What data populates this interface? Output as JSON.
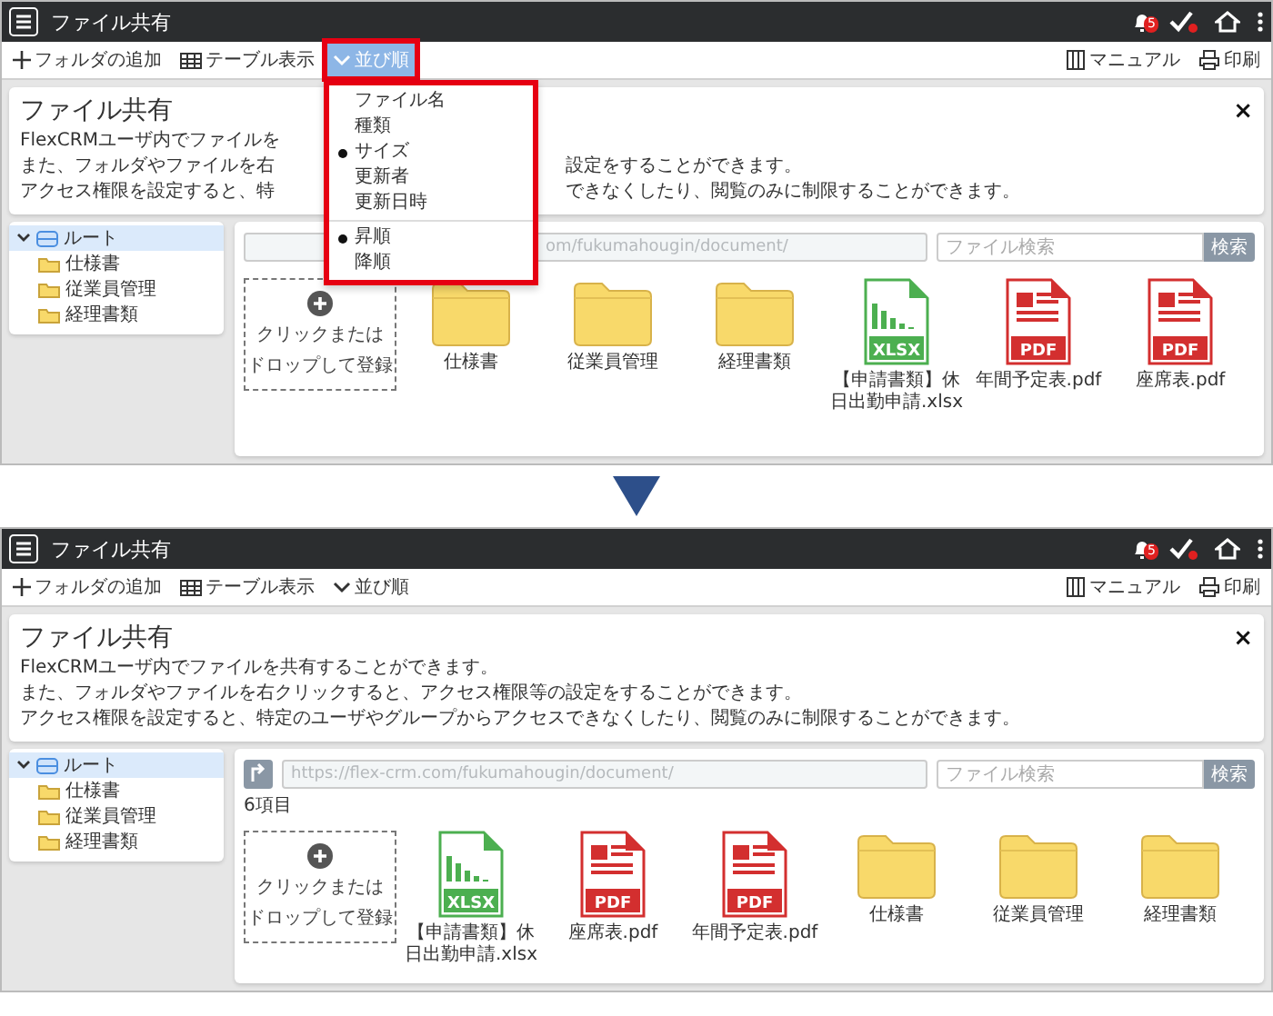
{
  "screens": [
    {
      "title": "ファイル共有",
      "notification_count": "5",
      "toolbar_left": [
        {
          "label": "フォルダの追加",
          "kind": "add",
          "active": false,
          "highlighted": false
        },
        {
          "label": "テーブル表示",
          "kind": "table",
          "active": false,
          "highlighted": false
        },
        {
          "label": "並び順",
          "kind": "sort",
          "active": true,
          "highlighted": true
        }
      ],
      "toolbar_right": [
        {
          "label": "マニュアル",
          "kind": "manual"
        },
        {
          "label": "印刷",
          "kind": "print"
        }
      ],
      "info": {
        "title": "ファイル共有",
        "close": "×",
        "lines": [
          {
            "text": "FlexCRMユーザ内でファイルを"
          },
          {
            "text": "また、フォルダやファイルを右",
            "after": "設定をすることができます。"
          },
          {
            "text": "アクセス権限を設定すると、特",
            "after": "できなくしたり、閲覧のみに制限することができます。"
          }
        ]
      },
      "tree": {
        "label": "ルート",
        "expanded": true,
        "selected": true,
        "children": [
          {
            "label": "仕様書",
            "selected": false
          },
          {
            "label": "従業員管理",
            "selected": false
          },
          {
            "label": "経理書類",
            "selected": false
          }
        ]
      },
      "path": "om/fukumahougin/document/",
      "search_placeholder": "ファイル検索",
      "search_button": "検索",
      "upload": [
        "クリックまたは",
        "ドロップして登録"
      ],
      "files": [
        {
          "kind": "folder",
          "name": "仕様書"
        },
        {
          "kind": "folder",
          "name": "従業員管理"
        },
        {
          "kind": "folder",
          "name": "経理書類"
        },
        {
          "kind": "xlsx",
          "badge": "XLSX",
          "name": "【申請書類】休日出勤申請.xlsx"
        },
        {
          "kind": "pdf",
          "badge": "PDF",
          "name": "年間予定表.pdf"
        },
        {
          "kind": "pdf",
          "badge": "PDF",
          "name": "座席表.pdf"
        }
      ],
      "sort_menu": {
        "highlighted": true,
        "groups": [
          [
            {
              "label": "ファイル名",
              "selected": false
            },
            {
              "label": "種類",
              "selected": false
            },
            {
              "label": "サイズ",
              "selected": true
            },
            {
              "label": "更新者",
              "selected": false
            },
            {
              "label": "更新日時",
              "selected": false
            }
          ],
          [
            {
              "label": "昇順",
              "selected": true
            },
            {
              "label": "降順",
              "selected": false
            }
          ]
        ]
      }
    },
    {
      "title": "ファイル共有",
      "notification_count": "5",
      "toolbar_left": [
        {
          "label": "フォルダの追加",
          "kind": "add",
          "active": false,
          "highlighted": false
        },
        {
          "label": "テーブル表示",
          "kind": "table",
          "active": false,
          "highlighted": false
        },
        {
          "label": "並び順",
          "kind": "sort",
          "active": false,
          "highlighted": false
        }
      ],
      "toolbar_right": [
        {
          "label": "マニュアル",
          "kind": "manual"
        },
        {
          "label": "印刷",
          "kind": "print"
        }
      ],
      "info": {
        "title": "ファイル共有",
        "close": "×",
        "lines": [
          {
            "text": "FlexCRMユーザ内でファイルを共有することができます。"
          },
          {
            "text": "また、フォルダやファイルを右クリックすると、アクセス権限等の設定をすることができます。"
          },
          {
            "text": "アクセス権限を設定すると、特定のユーザやグループからアクセスできなくしたり、閲覧のみに制限することができます。"
          }
        ]
      },
      "tree": {
        "label": "ルート",
        "expanded": true,
        "selected": true,
        "children": [
          {
            "label": "仕様書",
            "selected": false
          },
          {
            "label": "従業員管理",
            "selected": false
          },
          {
            "label": "経理書類",
            "selected": false
          }
        ]
      },
      "up_button": true,
      "path": "https://flex-crm.com/fukumahougin/document/",
      "search_placeholder": "ファイル検索",
      "search_button": "検索",
      "count": "6項目",
      "upload": [
        "クリックまたは",
        "ドロップして登録"
      ],
      "files": [
        {
          "kind": "xlsx",
          "badge": "XLSX",
          "name": "【申請書類】休日出勤申請.xlsx"
        },
        {
          "kind": "pdf",
          "badge": "PDF",
          "name": "座席表.pdf"
        },
        {
          "kind": "pdf",
          "badge": "PDF",
          "name": "年間予定表.pdf"
        },
        {
          "kind": "folder",
          "name": "仕様書"
        },
        {
          "kind": "folder",
          "name": "従業員管理"
        },
        {
          "kind": "folder",
          "name": "経理書類"
        }
      ]
    }
  ]
}
